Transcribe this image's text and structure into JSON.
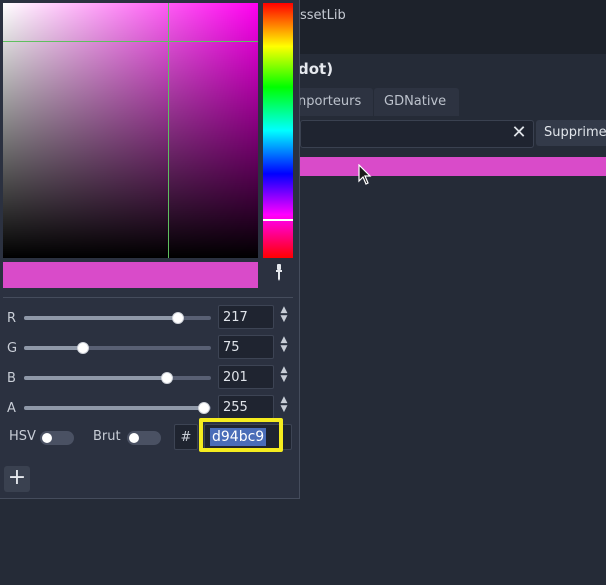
{
  "background": {
    "toolbar_text": "ssetLib",
    "dialog_title": "dot)",
    "tabs": [
      "nporteurs",
      "GDNative"
    ],
    "clear_icon": "close-icon",
    "delete_button": "Supprime",
    "selected_row_color": "#d94bc9"
  },
  "color_picker": {
    "current_color": "#d94bc9",
    "picker_icon": "eyedropper-icon",
    "channels": [
      {
        "label": "R",
        "value": "217",
        "max": 255
      },
      {
        "label": "G",
        "value": "75",
        "max": 255
      },
      {
        "label": "B",
        "value": "201",
        "max": 255
      },
      {
        "label": "A",
        "value": "255",
        "max": 255
      }
    ],
    "hsv_label": "HSV",
    "hsv_on": false,
    "raw_label": "Brut",
    "raw_on": false,
    "hash_label": "#",
    "hex_value": "d94bc9",
    "add_preset_label": "+"
  }
}
